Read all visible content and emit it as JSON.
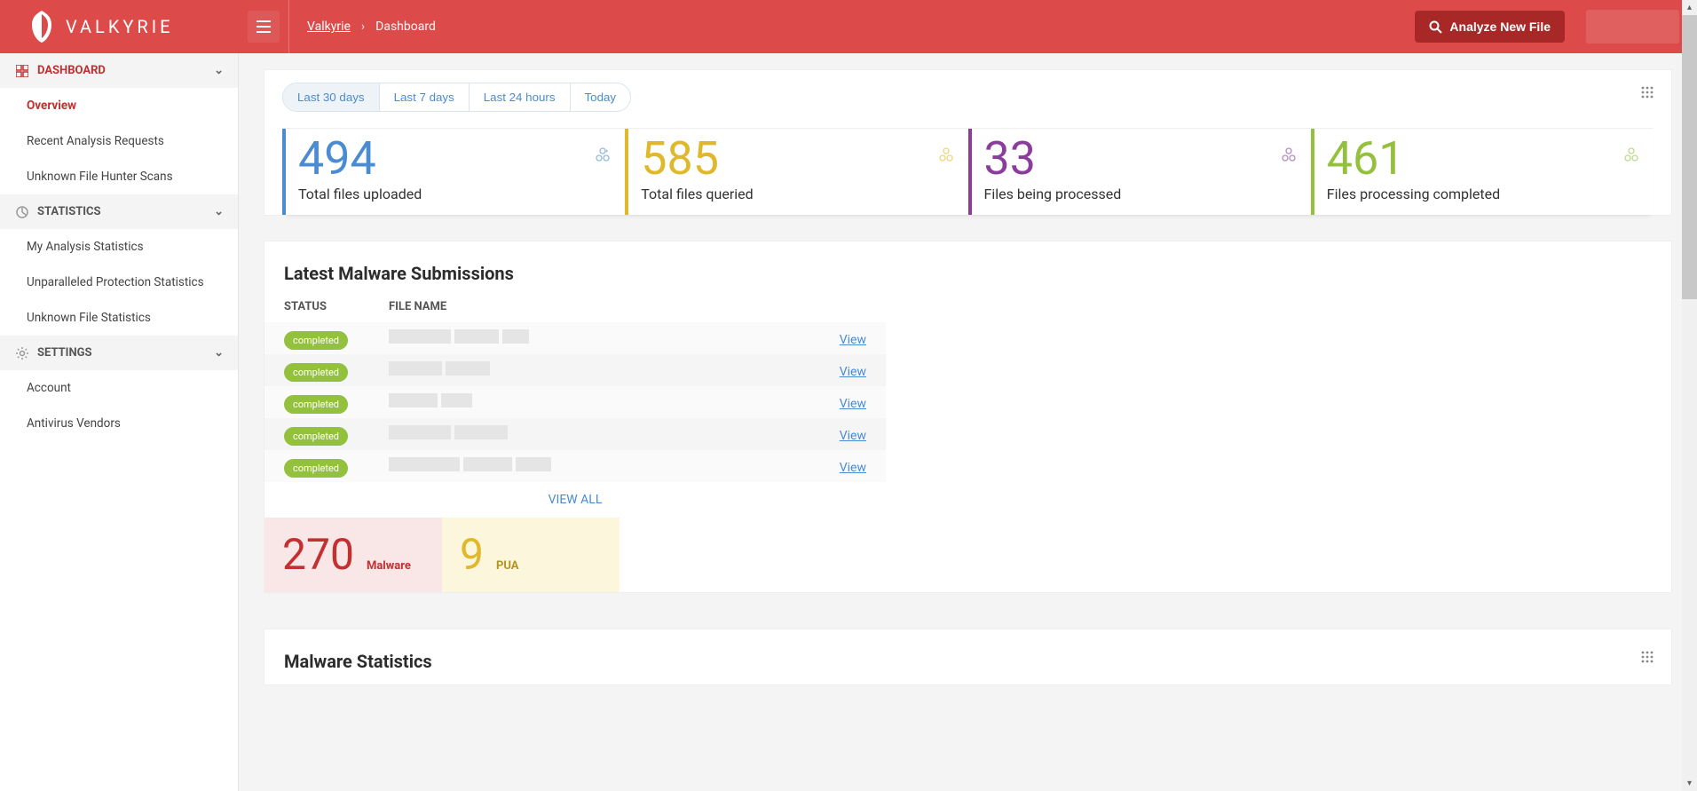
{
  "brand": {
    "name": "VALKYRIE"
  },
  "breadcrumb": {
    "root": "Valkyrie",
    "current": "Dashboard"
  },
  "header": {
    "analyze_label": "Analyze New File"
  },
  "sidebar": {
    "sections": [
      {
        "title": "DASHBOARD",
        "items": [
          "Overview",
          "Recent Analysis Requests",
          "Unknown File Hunter Scans"
        ],
        "active_index": 0
      },
      {
        "title": "STATISTICS",
        "items": [
          "My Analysis Statistics",
          "Unparalleled Protection Statistics",
          "Unknown File Statistics"
        ]
      },
      {
        "title": "SETTINGS",
        "items": [
          "Account",
          "Antivirus Vendors"
        ]
      }
    ]
  },
  "timerange": {
    "options": [
      "Last 30 days",
      "Last 7 days",
      "Last 24 hours",
      "Today"
    ],
    "active_index": 0
  },
  "stats": [
    {
      "value": "494",
      "label": "Total files uploaded",
      "tone": "blue"
    },
    {
      "value": "585",
      "label": "Total files queried",
      "tone": "gold"
    },
    {
      "value": "33",
      "label": "Files being processed",
      "tone": "purple"
    },
    {
      "value": "461",
      "label": "Files processing completed",
      "tone": "green"
    }
  ],
  "submissions": {
    "title": "Latest Malware Submissions",
    "columns": {
      "status": "STATUS",
      "file": "FILE NAME"
    },
    "rows": [
      {
        "status": "completed",
        "action": "View"
      },
      {
        "status": "completed",
        "action": "View"
      },
      {
        "status": "completed",
        "action": "View"
      },
      {
        "status": "completed",
        "action": "View"
      },
      {
        "status": "completed",
        "action": "View"
      }
    ],
    "view_all": "VIEW ALL",
    "counts": {
      "malware": {
        "value": "270",
        "label": "Malware"
      },
      "pua": {
        "value": "9",
        "label": "PUA"
      }
    }
  },
  "malware_stats": {
    "title": "Malware Statistics"
  }
}
